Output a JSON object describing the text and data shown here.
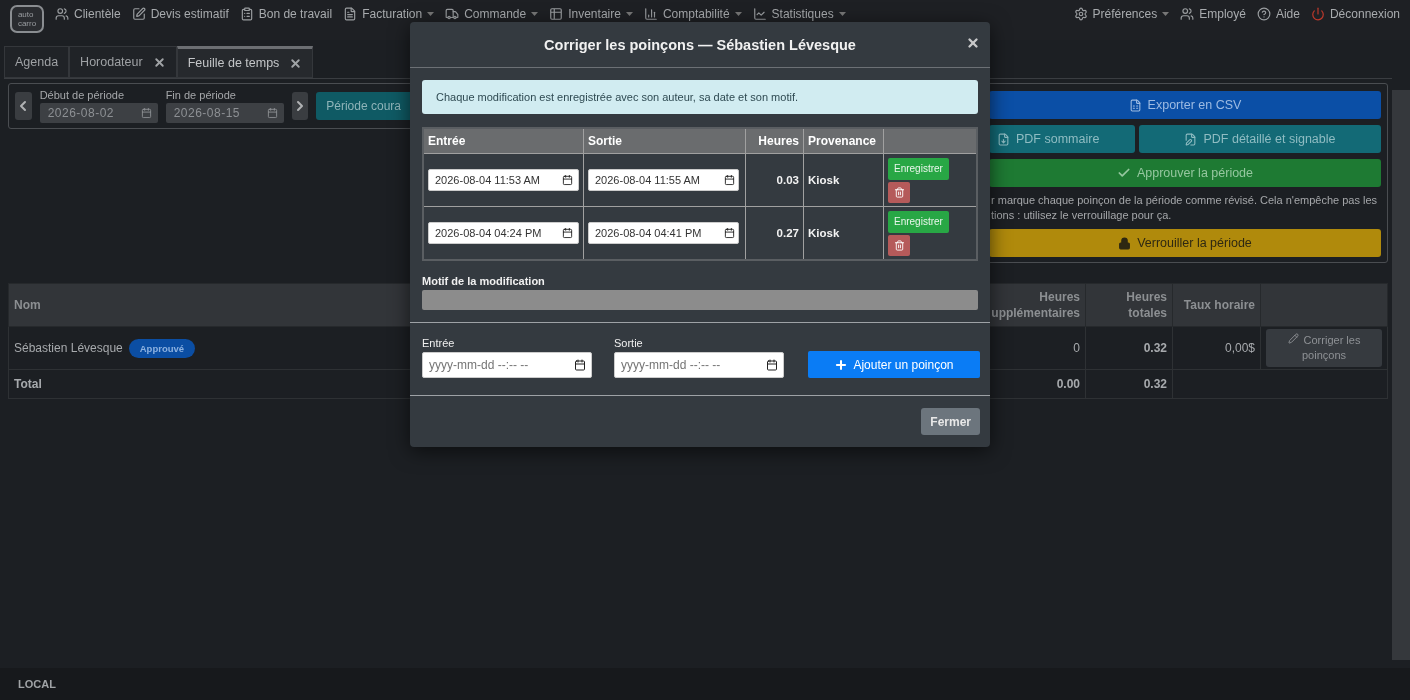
{
  "navbar": {
    "logo": [
      "auto",
      "carro"
    ],
    "items": [
      {
        "label": "Clientèle",
        "dropdown": false
      },
      {
        "label": "Devis estimatif",
        "dropdown": false
      },
      {
        "label": "Bon de travail",
        "dropdown": false
      },
      {
        "label": "Facturation",
        "dropdown": true
      },
      {
        "label": "Commande",
        "dropdown": true
      },
      {
        "label": "Inventaire",
        "dropdown": true
      },
      {
        "label": "Comptabilité",
        "dropdown": true
      },
      {
        "label": "Statistiques",
        "dropdown": true
      }
    ],
    "right_items": [
      {
        "label": "Préférences",
        "dropdown": true
      },
      {
        "label": "Employé",
        "dropdown": false
      },
      {
        "label": "Aide",
        "dropdown": false
      },
      {
        "label": "Déconnexion",
        "dropdown": false
      }
    ]
  },
  "tabs": [
    {
      "label": "Agenda",
      "closable": false,
      "selected": false
    },
    {
      "label": "Horodateur",
      "closable": true,
      "selected": false
    },
    {
      "label": "Feuille de temps",
      "closable": true,
      "selected": true
    }
  ],
  "period": {
    "start_label": "Début de période",
    "start_value": "2026-08-02",
    "end_label": "Fin de période",
    "end_value": "2026-08-15",
    "current_button": "Période coura"
  },
  "actions": {
    "export": "Exporter en CSV",
    "pdf_summary": "PDF sommaire",
    "pdf_detailed": "PDF détaillé et signable",
    "approve": "Approuver la période",
    "note": [
      "r marque chaque poinçon de la période comme révisé. Cela n'empêche pas les",
      "tions : utilisez le verrouillage pour ça."
    ],
    "lock": "Verrouiller la période"
  },
  "table": {
    "columns": [
      {
        "lines": [
          "Nom"
        ]
      },
      {
        "lines": [
          "Heures",
          "upplémentaires"
        ]
      },
      {
        "lines": [
          "Heures",
          "totales"
        ]
      },
      {
        "lines": [
          "Taux horaire"
        ]
      }
    ],
    "rows": [
      {
        "name": "Sébastien Lévesque",
        "badge": "Approuvé",
        "overtime": "0",
        "total_hours": "0.32",
        "rate": "0,00$",
        "action": "Corriger les poinçons"
      }
    ],
    "total": {
      "label": "Total",
      "overtime": "0.00",
      "total_hours": "0.32"
    }
  },
  "modal": {
    "title": "Corriger les poinçons — Sébastien Lévesque",
    "alert": "Chaque modification est enregistrée avec son auteur, sa date et son motif.",
    "columns": [
      "Entrée",
      "Sortie",
      "Heures",
      "Provenance"
    ],
    "punches": [
      {
        "entry": "2026-08-04 11:53 AM",
        "exit": "2026-08-04 11:55 AM",
        "hours": "0.03",
        "source": "Kiosk",
        "save": "Enregistrer"
      },
      {
        "entry": "2026-08-04 04:24 PM",
        "exit": "2026-08-04 04:41 PM",
        "hours": "0.27",
        "source": "Kiosk",
        "save": "Enregistrer"
      }
    ],
    "reason_label": "Motif de la modification",
    "new_entry_label": "Entrée",
    "new_entry_placeholder": "yyyy-mm-dd --:-- --",
    "new_exit_label": "Sortie",
    "new_exit_placeholder": "yyyy-mm-dd --:-- --",
    "add_button": "Ajouter un poinçon",
    "close_button": "Fermer"
  },
  "status_bar": "LOCAL"
}
